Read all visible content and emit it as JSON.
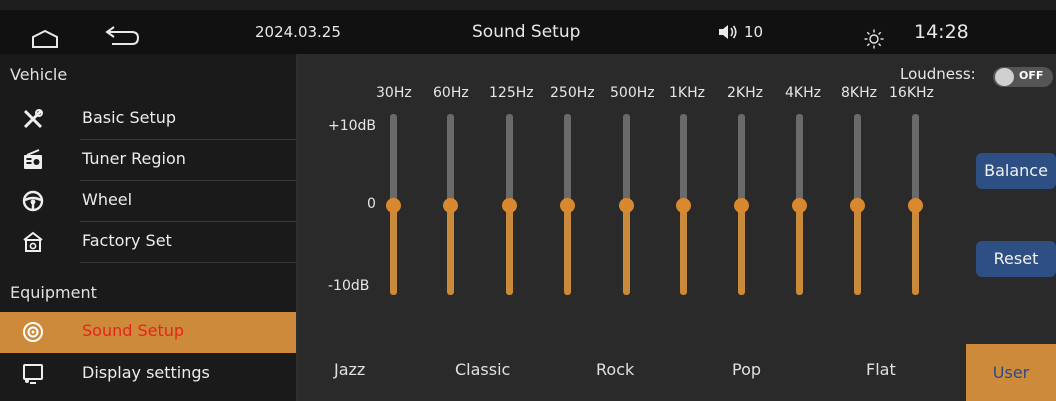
{
  "status_bar": {
    "date": "2024.03.25",
    "title": "Sound Setup",
    "volume": "10",
    "time": "14:28"
  },
  "sidebar": {
    "sections": [
      {
        "label": "Vehicle"
      },
      {
        "label": "Equipment"
      }
    ],
    "items": [
      {
        "label": "Basic Setup",
        "icon": "wrench-screwdriver-icon"
      },
      {
        "label": "Tuner Region",
        "icon": "radio-icon"
      },
      {
        "label": "Wheel",
        "icon": "steering-wheel-icon"
      },
      {
        "label": "Factory Set",
        "icon": "factory-home-icon"
      },
      {
        "label": "Sound Setup",
        "icon": "speaker-icon",
        "active": true
      },
      {
        "label": "Display settings",
        "icon": "display-icon"
      }
    ]
  },
  "equalizer": {
    "loudness_label": "Loudness:",
    "loudness_state": "OFF",
    "db_labels": {
      "top": "+10dB",
      "mid": "0",
      "bottom": "-10dB"
    },
    "range_db": [
      -10,
      10
    ],
    "bands": [
      {
        "freq": "30Hz",
        "gain_db": 0
      },
      {
        "freq": "60Hz",
        "gain_db": 0
      },
      {
        "freq": "125Hz",
        "gain_db": 0
      },
      {
        "freq": "250Hz",
        "gain_db": 0
      },
      {
        "freq": "500Hz",
        "gain_db": 0
      },
      {
        "freq": "1KHz",
        "gain_db": 0
      },
      {
        "freq": "2KHz",
        "gain_db": 0
      },
      {
        "freq": "4KHz",
        "gain_db": 0
      },
      {
        "freq": "8KHz",
        "gain_db": 0
      },
      {
        "freq": "16KHz",
        "gain_db": 0
      }
    ],
    "balance_label": "Balance",
    "reset_label": "Reset",
    "presets": [
      "Jazz",
      "Classic",
      "Rock",
      "Pop",
      "Flat",
      "User"
    ],
    "selected_preset": "User"
  },
  "colors": {
    "accent": "#cd8a3a",
    "active_text": "#e8251a",
    "button_blue": "#2e4f84",
    "slider_fill": "#c98a3c"
  }
}
